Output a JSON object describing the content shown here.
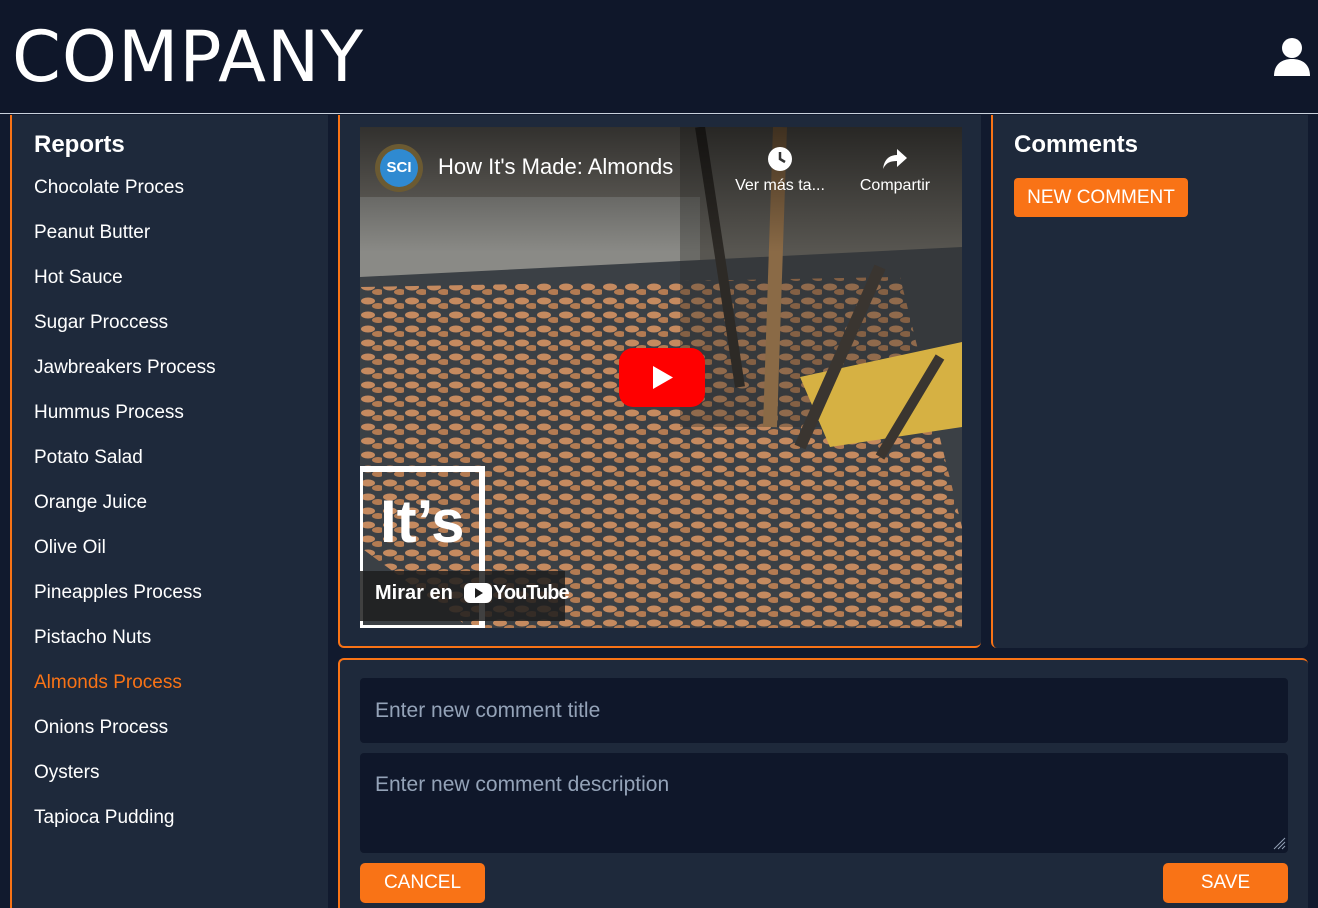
{
  "header": {
    "logo": "COMPANY",
    "user_icon": "user-icon"
  },
  "sidebar": {
    "title": "Reports",
    "items": [
      {
        "label": "Chocolate Proces"
      },
      {
        "label": "Peanut Butter"
      },
      {
        "label": "Hot Sauce"
      },
      {
        "label": "Sugar Proccess"
      },
      {
        "label": "Jawbreakers Process"
      },
      {
        "label": "Hummus Process"
      },
      {
        "label": "Potato Salad"
      },
      {
        "label": "Orange Juice"
      },
      {
        "label": "Olive Oil"
      },
      {
        "label": "Pineapples Process"
      },
      {
        "label": "Pistacho Nuts"
      },
      {
        "label": "Almonds Process",
        "active": true
      },
      {
        "label": "Onions Process"
      },
      {
        "label": "Oysters"
      },
      {
        "label": "Tapioca Pudding"
      }
    ]
  },
  "video": {
    "channel_badge": "SCI",
    "title": "How It's Made: Almonds",
    "watch_later": "Ver más ta...",
    "share": "Compartir",
    "watch_on": "Mirar en",
    "youtube": "YouTube",
    "overlay_text": "It’s"
  },
  "comments": {
    "title": "Comments",
    "new_comment": "NEW COMMENT"
  },
  "form": {
    "title_placeholder": "Enter new comment title",
    "description_placeholder": "Enter new comment description",
    "cancel": "CANCEL",
    "save": "SAVE"
  },
  "colors": {
    "accent": "#f97316",
    "background": "#0f172a",
    "panel": "#1e293b"
  }
}
